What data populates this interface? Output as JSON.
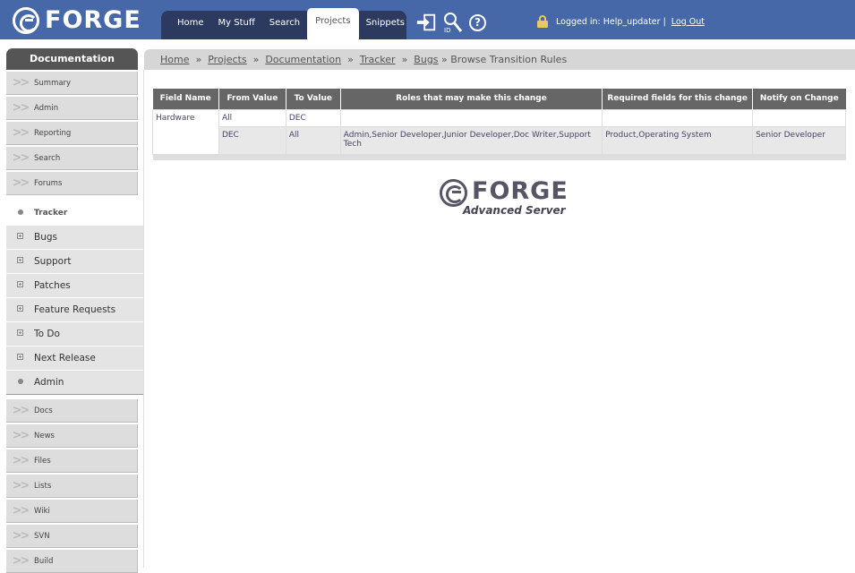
{
  "brand": {
    "logo_text": "FORGE"
  },
  "topnav": {
    "tabs": [
      "Home",
      "My Stuff",
      "Search",
      "Projects",
      "Snippets"
    ],
    "active": "Projects"
  },
  "tool_icons": [
    "login-icon",
    "search-id-icon",
    "help-icon"
  ],
  "tool_labels": {
    "help_glyph": "?"
  },
  "user": {
    "logged_in_text": "Logged in: Help_updater |",
    "logout_label": "Log Out"
  },
  "sidebar": {
    "title": "Documentation",
    "items": [
      "Summary",
      "Admin",
      "Reporting",
      "Search",
      "Forums"
    ],
    "tracker": {
      "label": "Tracker",
      "sub_items": [
        "Bugs",
        "Support",
        "Patches",
        "Feature Requests",
        "To Do",
        "Next Release"
      ],
      "admin_label": "Admin"
    },
    "lower_items": [
      "Docs",
      "News",
      "Files",
      "Lists",
      "Wiki",
      "SVN",
      "Build"
    ]
  },
  "breadcrumb": {
    "links": [
      "Home",
      "Projects",
      "Documentation",
      "Tracker",
      "Bugs"
    ],
    "current": "» Browse Transition Rules",
    "separator": "»"
  },
  "table": {
    "headers": [
      "Field Name",
      "From Value",
      "To Value",
      "Roles that may make this change",
      "Required fields for this change",
      "Notify on Change"
    ],
    "field_name": "Hardware",
    "rows": [
      {
        "from": "All",
        "to": "DEC",
        "roles": "",
        "required": "",
        "notify": ""
      },
      {
        "from": "DEC",
        "to": "All",
        "roles": "Admin,Senior Developer,Junior Developer,Doc Writer,Support Tech",
        "required": "Product,Operating System",
        "notify": "Senior Developer"
      }
    ]
  },
  "footer_logo": {
    "text": "FORGE",
    "subtitle": "Advanced Server"
  },
  "colors": {
    "header_bg": "#4668a8",
    "nav_dark": "#2b3a5e",
    "table_header": "#666666"
  }
}
